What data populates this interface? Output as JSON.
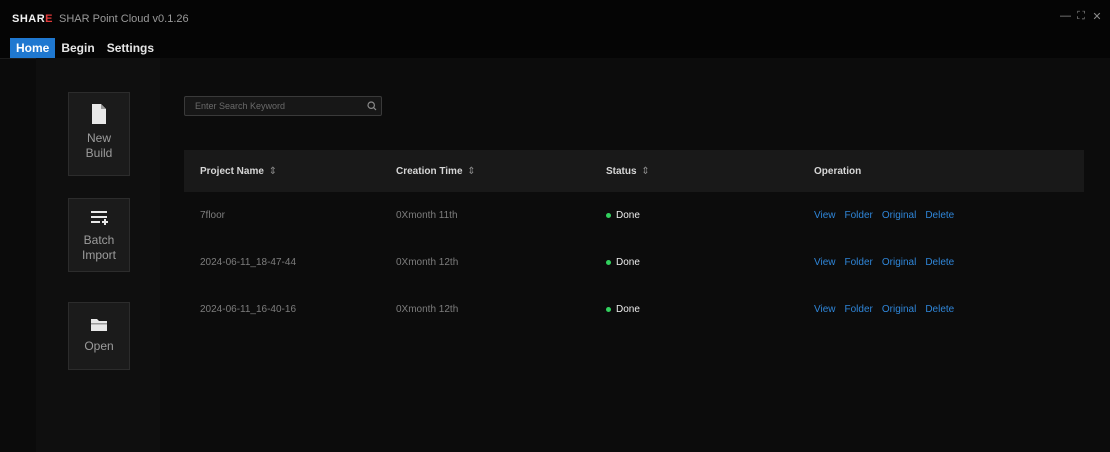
{
  "titlebar": {
    "logo_main": "SHAR",
    "logo_accent": "E",
    "title": "SHAR Point Cloud v0.1.26",
    "controls": {
      "minimize": "—",
      "maximize": "⛶",
      "close": "✕"
    }
  },
  "menu": {
    "items": [
      {
        "label": "Home",
        "active": true
      },
      {
        "label": "Begin",
        "active": false
      },
      {
        "label": "Settings",
        "active": false
      }
    ]
  },
  "tools": {
    "new_build": {
      "line1": "New",
      "line2": "Build",
      "icon": "file-icon"
    },
    "batch_import": {
      "line1": "Batch",
      "line2": "Import",
      "icon": "list-add-icon"
    },
    "open": {
      "label": "Open",
      "icon": "folder-icon"
    }
  },
  "search": {
    "placeholder": "Enter Search Keyword",
    "icon": "search-icon"
  },
  "table": {
    "headers": {
      "name": "Project Name",
      "time": "Creation Time",
      "status": "Status",
      "operation": "Operation",
      "sort_glyph": "⇕"
    },
    "rows": [
      {
        "name": "7floor",
        "time": "0Xmonth 11th",
        "status": "Done"
      },
      {
        "name": "2024-06-11_18-47-44",
        "time": "0Xmonth 12th",
        "status": "Done"
      },
      {
        "name": "2024-06-11_16-40-16",
        "time": "0Xmonth 12th",
        "status": "Done"
      }
    ],
    "ops": {
      "view": "View",
      "folder": "Folder",
      "original": "Original",
      "delete": "Delete"
    }
  },
  "colors": {
    "accent": "#1f78d0",
    "link": "#2f86d9",
    "status_ok": "#32d15e",
    "logo_accent": "#e23a3a"
  }
}
